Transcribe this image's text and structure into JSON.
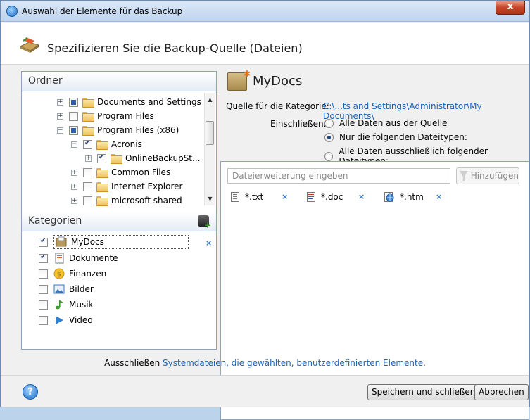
{
  "window": {
    "title": "Auswahl der Elemente für das Backup",
    "close_label": "x"
  },
  "header": {
    "title": "Spezifizieren Sie die Backup-Quelle (Dateien)"
  },
  "folders": {
    "heading": "Ordner",
    "items": [
      {
        "label": "Documents and Settings",
        "state": "partial"
      },
      {
        "label": "Program Files",
        "state": "unchecked"
      },
      {
        "label": "Program Files (x86)",
        "state": "partial"
      },
      {
        "label": "Acronis",
        "state": "checked"
      },
      {
        "label": "OnlineBackupSt...",
        "state": "checked"
      },
      {
        "label": "Common Files",
        "state": "unchecked"
      },
      {
        "label": "Internet Explorer",
        "state": "unchecked"
      },
      {
        "label": "microsoft shared",
        "state": "unchecked"
      }
    ]
  },
  "categories": {
    "heading": "Kategorien",
    "items": [
      {
        "label": "MyDocs",
        "checked": true,
        "icon": "mydocs-icon"
      },
      {
        "label": "Dokumente",
        "checked": true,
        "icon": "document-icon"
      },
      {
        "label": "Finanzen",
        "checked": false,
        "icon": "coin-icon"
      },
      {
        "label": "Bilder",
        "checked": false,
        "icon": "picture-icon"
      },
      {
        "label": "Musik",
        "checked": false,
        "icon": "music-note-icon"
      },
      {
        "label": "Video",
        "checked": false,
        "icon": "play-icon"
      }
    ],
    "delete_label": "×"
  },
  "detail": {
    "title": "MyDocs",
    "source_label": "Quelle für die Kategorie:",
    "source_path": "C:\\...ts and Settings\\Administrator\\My Documents\\",
    "include_label": "Einschließen:",
    "options": [
      {
        "label": "Alle Daten aus der Quelle",
        "selected": false
      },
      {
        "label": "Nur die folgenden Dateitypen:",
        "selected": true
      },
      {
        "label": "Alle Daten ausschließlich folgender Dateitypen:",
        "selected": false
      }
    ],
    "extension_placeholder": "Dateierweiterung eingeben",
    "add_label": "Hinzufügen",
    "file_types": [
      {
        "label": "*.txt",
        "icon": "text-file-icon"
      },
      {
        "label": "*.doc",
        "icon": "doc-file-icon"
      },
      {
        "label": "*.htm",
        "icon": "html-file-icon"
      }
    ],
    "remove_label": "×"
  },
  "exclude": {
    "prefix": "Ausschließen",
    "link": "Systemdateien, die gewählten, benutzerdefinierten Elemente."
  },
  "footer": {
    "help_label": "?",
    "save_label": "Speichern und schließen",
    "cancel_label": "Abbrechen"
  }
}
